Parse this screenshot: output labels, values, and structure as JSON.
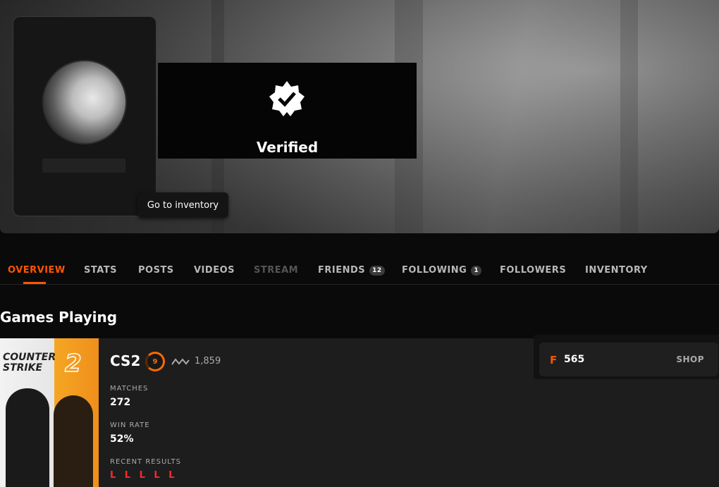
{
  "profile": {
    "verified_label": "Verified",
    "tooltip": "Go to inventory"
  },
  "nav": {
    "tabs": [
      {
        "label": "OVERVIEW",
        "state": "active"
      },
      {
        "label": "STATS",
        "state": "normal"
      },
      {
        "label": "POSTS",
        "state": "normal"
      },
      {
        "label": "VIDEOS",
        "state": "normal"
      },
      {
        "label": "STREAM",
        "state": "disabled"
      },
      {
        "label": "FRIENDS",
        "count": "12",
        "state": "normal"
      },
      {
        "label": "FOLLOWING",
        "count": "1",
        "state": "normal"
      },
      {
        "label": "FOLLOWERS",
        "state": "normal"
      },
      {
        "label": "INVENTORY",
        "state": "normal"
      }
    ]
  },
  "games": {
    "title": "Games Playing",
    "game": {
      "art_line1": "COUNTER",
      "art_line2": "STRIKE",
      "art_number": "2",
      "name": "CS2",
      "level": "9",
      "elo": "1,859",
      "matches_label": "MATCHES",
      "matches": "272",
      "win_rate_label": "WIN RATE",
      "win_rate": "52%",
      "recent_label": "RECENT RESULTS",
      "recent": "L L L L L"
    }
  },
  "shop": {
    "points_icon": "F",
    "points": "565",
    "button": "SHOP"
  },
  "colors": {
    "accent": "#ff5500",
    "loss": "#ff2a2a"
  },
  "icons": [
    "verified-badge-icon",
    "elo-chart-icon",
    "points-icon"
  ]
}
